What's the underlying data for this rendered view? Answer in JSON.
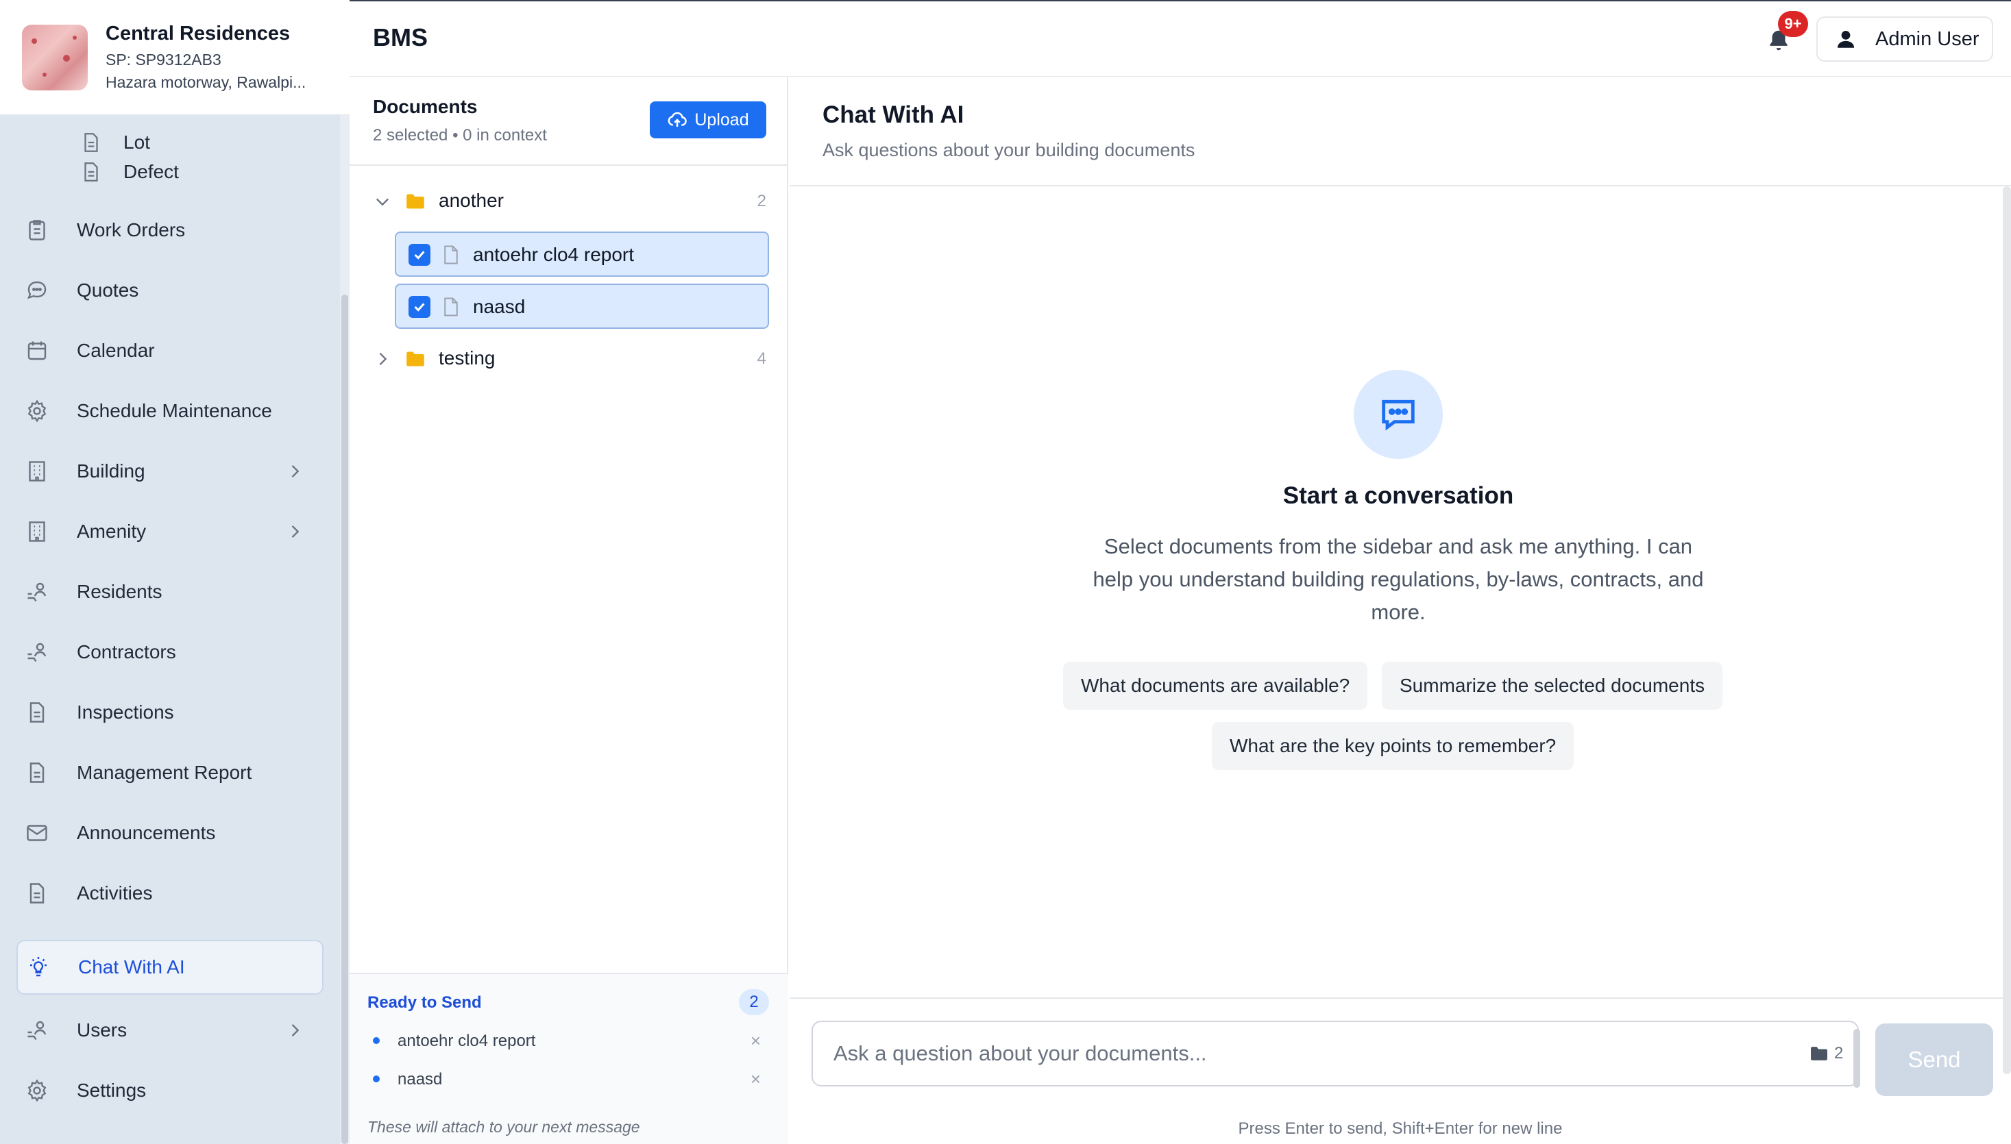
{
  "brand": {
    "name": "Central Residences",
    "sp": "SP: SP9312AB3",
    "address": "Hazara motorway, Rawalpi..."
  },
  "sidebar": {
    "items": [
      {
        "label": "Lot",
        "icon": "document-icon",
        "sub": true
      },
      {
        "label": "Defect",
        "icon": "document-icon",
        "sub": true
      },
      {
        "label": "Work Orders",
        "icon": "clipboard-icon"
      },
      {
        "label": "Quotes",
        "icon": "chat-bubble-icon"
      },
      {
        "label": "Calendar",
        "icon": "calendar-icon"
      },
      {
        "label": "Schedule Maintenance",
        "icon": "gear-icon"
      },
      {
        "label": "Building",
        "icon": "building-icon",
        "expandable": true
      },
      {
        "label": "Amenity",
        "icon": "building-icon",
        "expandable": true
      },
      {
        "label": "Residents",
        "icon": "people-icon"
      },
      {
        "label": "Contractors",
        "icon": "people-icon"
      },
      {
        "label": "Inspections",
        "icon": "document-icon"
      },
      {
        "label": "Management Report",
        "icon": "document-icon"
      },
      {
        "label": "Announcements",
        "icon": "mail-icon"
      },
      {
        "label": "Activities",
        "icon": "document-icon"
      },
      {
        "label": "Chat With AI",
        "icon": "lightbulb-icon",
        "active": true
      },
      {
        "label": "Users",
        "icon": "people-icon",
        "expandable": true
      },
      {
        "label": "Settings",
        "icon": "gear-icon"
      }
    ]
  },
  "header": {
    "title": "BMS",
    "notification_badge": "9+",
    "user_label": "Admin User"
  },
  "documents": {
    "title": "Documents",
    "meta": "2 selected • 0 in context",
    "upload_label": "Upload",
    "folders": [
      {
        "name": "another",
        "count": "2",
        "expanded": true,
        "files": [
          {
            "name": "antoehr clo4 report",
            "checked": true
          },
          {
            "name": "naasd",
            "checked": true
          }
        ]
      },
      {
        "name": "testing",
        "count": "4",
        "expanded": false,
        "files": []
      }
    ],
    "ready": {
      "title": "Ready to Send",
      "count": "2",
      "items": [
        "antoehr clo4 report",
        "naasd"
      ],
      "remove_glyph": "×",
      "note": "These will attach to your next message"
    }
  },
  "chat": {
    "title": "Chat With AI",
    "subtitle": "Ask questions about your building documents",
    "empty_title": "Start a conversation",
    "empty_desc": "Select documents from the sidebar and ask me anything. I can help you understand building regulations, by-laws, contracts, and more.",
    "suggestions": [
      "What documents are available?",
      "Summarize the selected documents",
      "What are the key points to remember?"
    ],
    "input_placeholder": "Ask a question about your documents...",
    "input_doc_count": "2",
    "send_label": "Send",
    "hint": "Press Enter to send, Shift+Enter for new line"
  },
  "colors": {
    "accent": "#1d6ff2",
    "sidebar_bg": "#dde5ef",
    "badge": "#dc2626",
    "folder": "#f5b40b"
  }
}
